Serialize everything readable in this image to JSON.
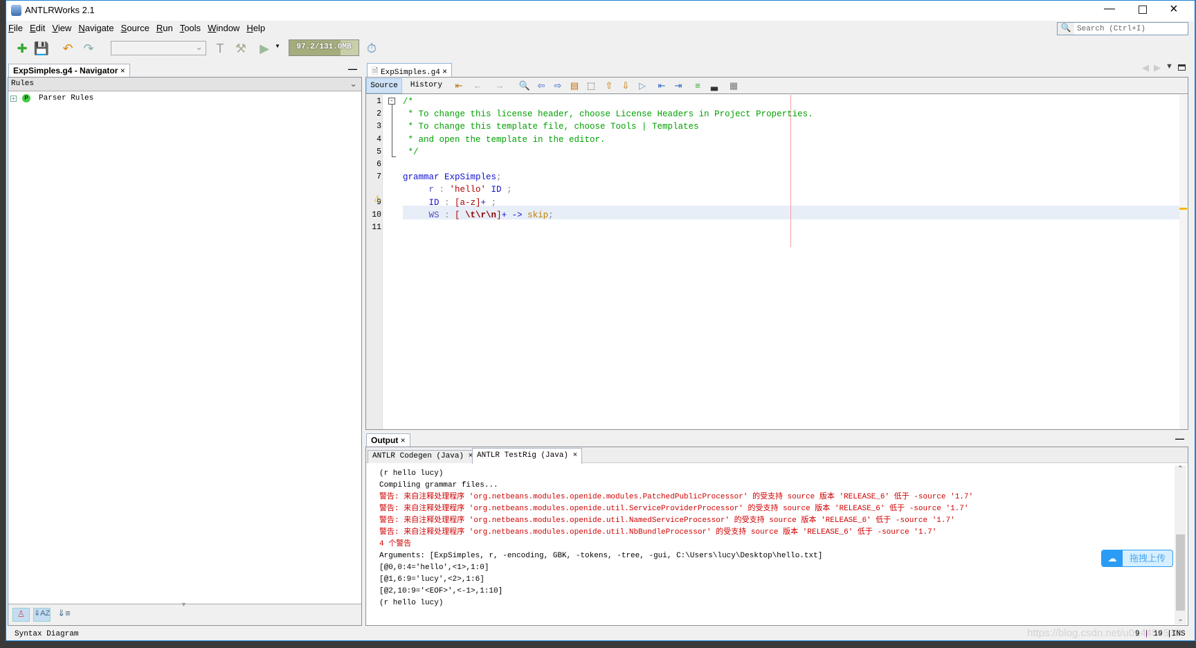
{
  "window": {
    "title": "ANTLRWorks 2.1"
  },
  "menu": [
    "File",
    "Edit",
    "View",
    "Navigate",
    "Source",
    "Run",
    "Tools",
    "Window",
    "Help"
  ],
  "search": {
    "placeholder": "Search (Ctrl+I)"
  },
  "toolbar": {
    "memory": "97.2/131.0MB",
    "memory_fraction": 0.74
  },
  "navigator": {
    "tab": "ExpSimples.g4 - Navigator",
    "combo": "Rules",
    "tree": [
      {
        "label": "Parser Rules",
        "badge": "P"
      }
    ]
  },
  "editor": {
    "tab": "ExpSimples.g4",
    "views": [
      "Source",
      "History"
    ],
    "active_line": 9,
    "lines": [
      [
        [
          "/*",
          "cm"
        ]
      ],
      [
        [
          " * To change this license header, choose License Headers in Project Properties.",
          "cm"
        ]
      ],
      [
        [
          " * To change this template file, choose Tools | Templates",
          "cm"
        ]
      ],
      [
        [
          " * and open the template in the editor.",
          "cm"
        ]
      ],
      [
        [
          " */",
          "cm"
        ]
      ],
      [],
      [
        [
          "grammar ExpSimples",
          "kw"
        ],
        [
          ";",
          "pu"
        ]
      ],
      [
        [
          "     r",
          "rl"
        ],
        [
          " : ",
          "pu"
        ],
        [
          "'hello'",
          "st"
        ],
        [
          " ID",
          "kw"
        ],
        [
          " ;",
          "pu"
        ]
      ],
      [
        [
          "     ID",
          "kw"
        ],
        [
          " : ",
          "pu"
        ],
        [
          "[a-z]",
          "st"
        ],
        [
          "+ ",
          "kw"
        ],
        [
          ";",
          "pu"
        ]
      ],
      [
        [
          "     WS",
          "rl"
        ],
        [
          " : ",
          "pu"
        ],
        [
          "[ ",
          "st"
        ],
        [
          "\\t\\r\\n",
          "esc"
        ],
        [
          "]",
          "st"
        ],
        [
          "+ -> ",
          "kw"
        ],
        [
          "skip",
          "sk"
        ],
        [
          ";",
          "pu"
        ]
      ],
      []
    ],
    "line_numbers": [
      "1",
      "2",
      "3",
      "4",
      "5",
      "6",
      "7",
      "8",
      "9",
      "10",
      "11"
    ]
  },
  "output": {
    "title": "Output",
    "tabs": [
      "ANTLR Codegen (Java)",
      "ANTLR TestRig (Java)"
    ],
    "lines": [
      {
        "t": "(r hello lucy)",
        "c": ""
      },
      {
        "t": "Compiling grammar files...",
        "c": ""
      },
      {
        "t": "警告: 来自注释处理程序 'org.netbeans.modules.openide.modules.PatchedPublicProcessor' 的受支持 source 版本 'RELEASE_6' 低于 -source '1.7'",
        "c": "red"
      },
      {
        "t": "警告: 来自注释处理程序 'org.netbeans.modules.openide.util.ServiceProviderProcessor' 的受支持 source 版本 'RELEASE_6' 低于 -source '1.7'",
        "c": "red"
      },
      {
        "t": "警告: 来自注释处理程序 'org.netbeans.modules.openide.util.NamedServiceProcessor' 的受支持 source 版本 'RELEASE_6' 低于 -source '1.7'",
        "c": "red"
      },
      {
        "t": "警告: 来自注释处理程序 'org.netbeans.modules.openide.util.NbBundleProcessor' 的受支持 source 版本 'RELEASE_6' 低于 -source '1.7'",
        "c": "red"
      },
      {
        "t": "4 个警告",
        "c": "red"
      },
      {
        "t": "Arguments: [ExpSimples, r, -encoding, GBK, -tokens, -tree, -gui, C:\\Users\\lucy\\Desktop\\hello.txt]",
        "c": ""
      },
      {
        "t": "[@0,0:4='hello',<1>,1:0]",
        "c": ""
      },
      {
        "t": "[@1,6:9='lucy',<2>,1:6]",
        "c": ""
      },
      {
        "t": "[@2,10:9='<EOF>',<-1>,1:10]",
        "c": ""
      },
      {
        "t": "(r hello lucy)",
        "c": ""
      }
    ]
  },
  "upload_badge": "拖拽上传",
  "status": {
    "left": "Syntax Diagram",
    "line": "9",
    "col": "19",
    "mode": "INS",
    "watermark": "https://blog.csdn.net/u014454538"
  }
}
